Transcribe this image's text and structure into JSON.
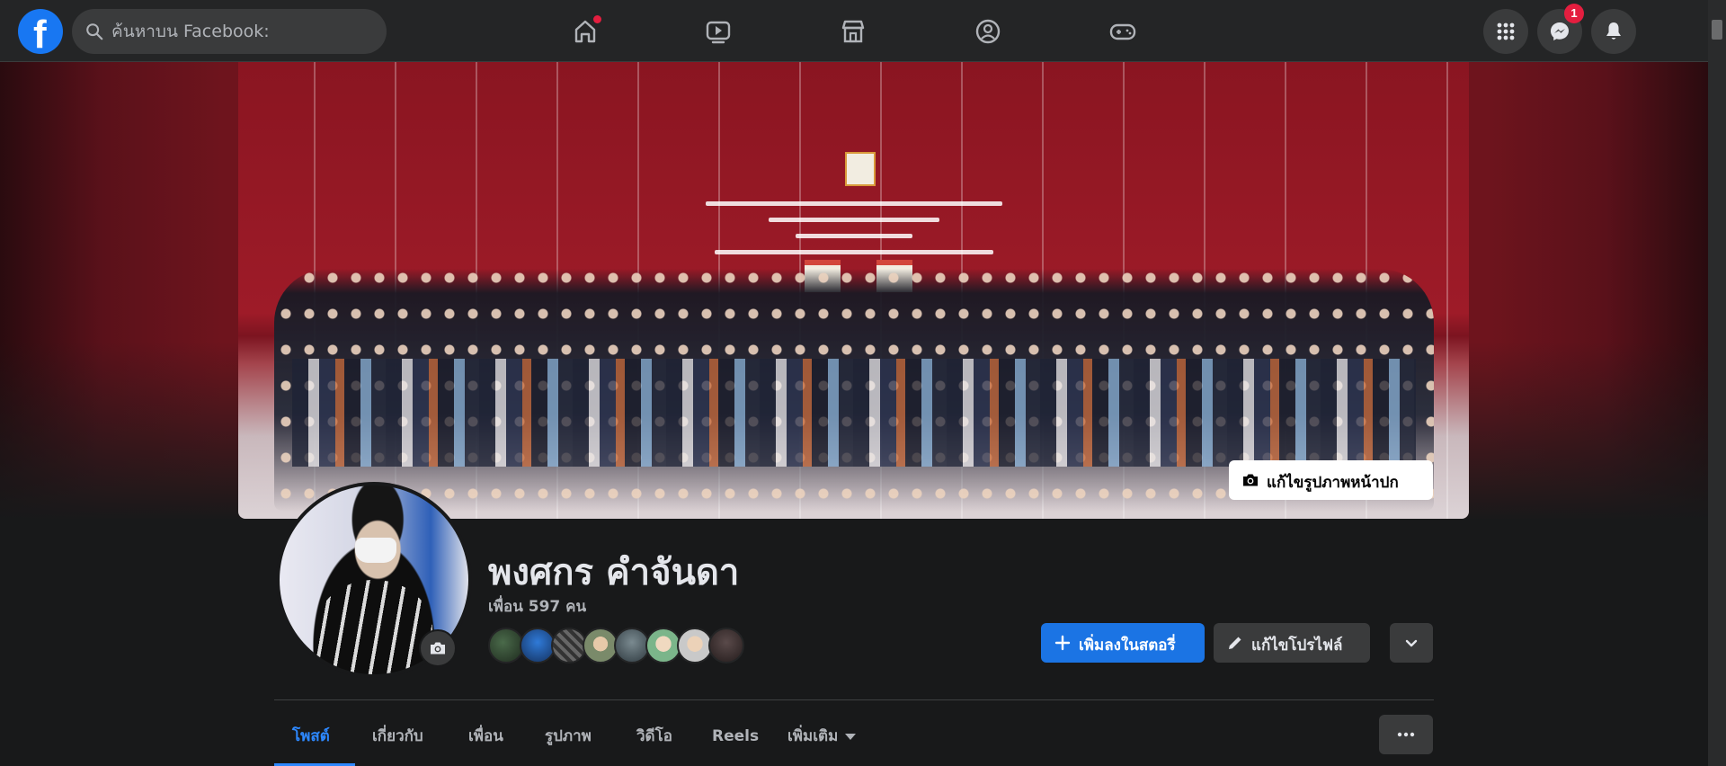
{
  "search": {
    "placeholder": "ค้นหาบน Facebook:"
  },
  "topbar": {
    "logo_letter": "f",
    "nav_icons": [
      "home-icon",
      "watch-icon",
      "marketplace-icon",
      "groups-icon",
      "gaming-icon"
    ],
    "home_has_notification": true,
    "menu_icon": "grid-menu-icon",
    "messenger_badge": "1",
    "notifications_icon": "bell-icon"
  },
  "cover": {
    "edit_label": "แก้ไขรูปภาพหน้าปก"
  },
  "profile": {
    "name": "พงศกร คำจันดา",
    "friends_label": "เพื่อน 597 คน",
    "friend_avatar_count": 8
  },
  "actions": {
    "add_story": "เพิ่มลงในสตอรี่",
    "edit_profile": "แก้ไขโปรไฟล์"
  },
  "tabs": [
    {
      "label": "โพสต์",
      "active": true
    },
    {
      "label": "เกี่ยวกับ",
      "active": false
    },
    {
      "label": "เพื่อน",
      "active": false
    },
    {
      "label": "รูปภาพ",
      "active": false
    },
    {
      "label": "วิดีโอ",
      "active": false
    },
    {
      "label": "Reels",
      "active": false
    },
    {
      "label": "เพิ่มเติม",
      "active": false
    }
  ],
  "colors": {
    "accent": "#1b74e4",
    "active_tab": "#2d88ff",
    "background": "#18191a",
    "surface": "#242526",
    "badge": "#e41e3f"
  }
}
